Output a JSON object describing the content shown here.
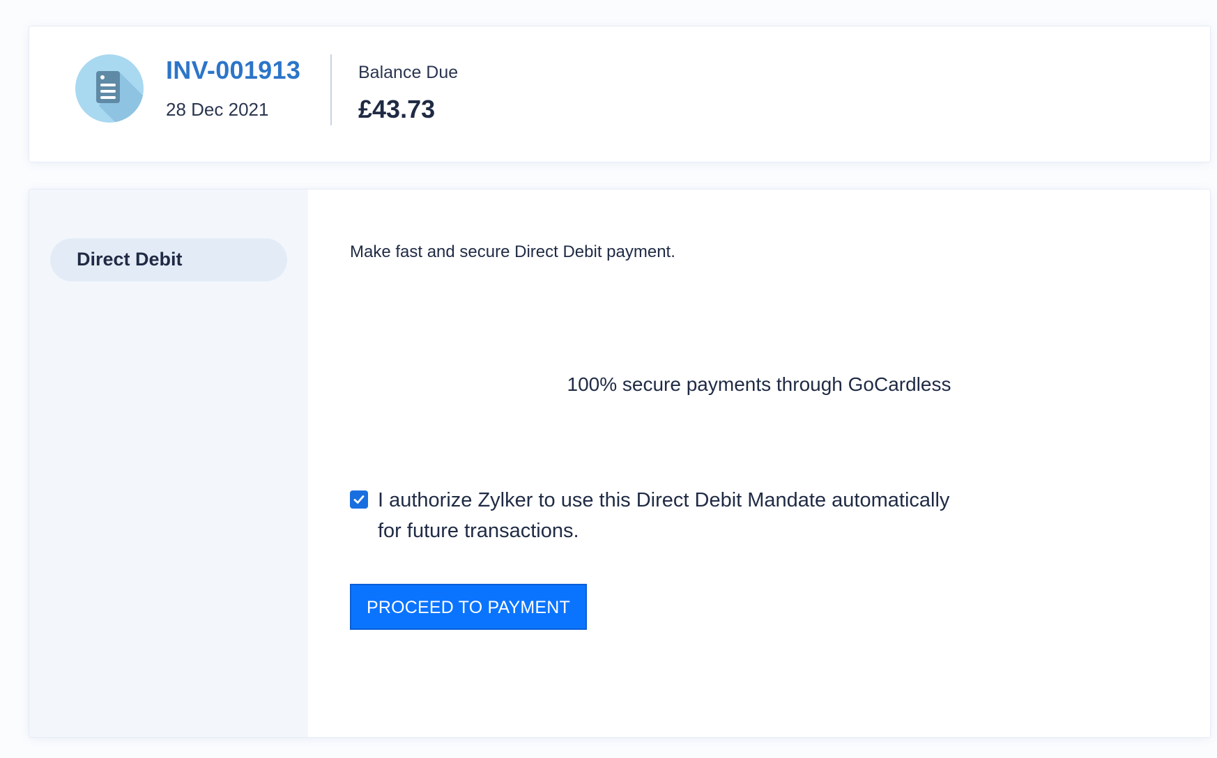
{
  "invoice": {
    "number": "INV-001913",
    "date": "28 Dec 2021",
    "icon": "invoice-document-icon"
  },
  "balance": {
    "label": "Balance Due",
    "amount": "£43.73"
  },
  "payment_methods": [
    {
      "label": "Direct Debit",
      "selected": true
    }
  ],
  "direct_debit": {
    "intro": "Make fast and secure Direct Debit payment.",
    "secure_note": "100% secure payments through GoCardless",
    "authorize": {
      "checked": true,
      "label": "I authorize Zylker to use this Direct Debit Mandate automatically for future transactions."
    },
    "proceed_label": "PROCEED TO PAYMENT"
  },
  "colors": {
    "invoice_number": "#2c75c8",
    "primary_button": "#0a74ff",
    "checkbox": "#1a6fe0",
    "sidebar_bg": "#f3f7fc"
  }
}
